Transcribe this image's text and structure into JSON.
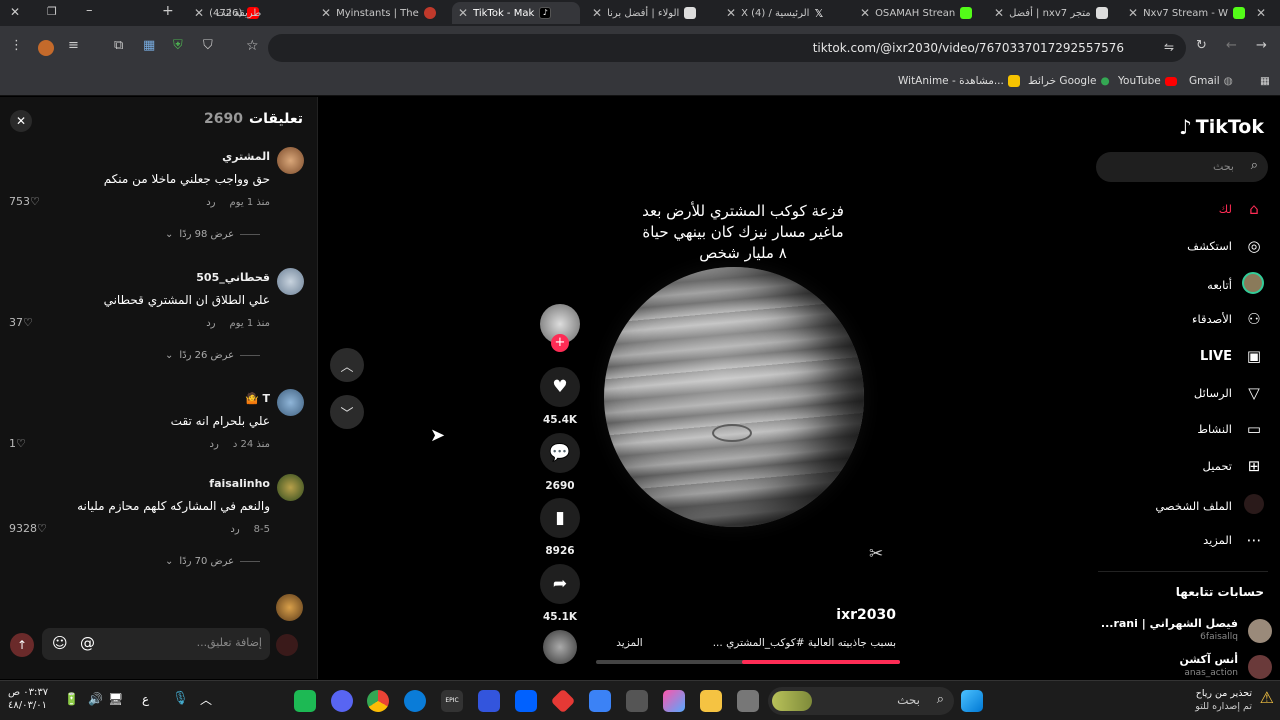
{
  "browser": {
    "tabs": [
      {
        "label": "طريقة انت",
        "active": false
      },
      {
        "label": "(4726)",
        "active": false
      },
      {
        "label": "Myinstants | The",
        "active": false
      },
      {
        "label": "TikTok - Mak",
        "active": true
      },
      {
        "label": "الولاء | أفضل برنا",
        "active": false
      },
      {
        "label": "الرئيسية / X (4)",
        "active": false
      },
      {
        "label": "OSAMAH Strean",
        "active": false
      },
      {
        "label": "متجر nxv7 | أفضل",
        "active": false
      },
      {
        "label": "Nxv7 Stream - W",
        "active": false
      }
    ],
    "url": "tiktok.com/@ixr2030/video/7670337017292557576",
    "bookmarks": [
      "Gmail",
      "YouTube",
      "خرائط Google",
      "WitAnime - مشاهدة..."
    ]
  },
  "comments": {
    "title": "تعليقات",
    "count": "2690",
    "close_icon": "close-icon",
    "items": [
      {
        "user": "المشتري",
        "text": "حق وواجب جعلني ماخلا من منكم",
        "time": "منذ 1 يوم",
        "reply": "رد",
        "likes": "753",
        "view_replies": "عرض 98 ردًا",
        "avatar_color": "#b07a4a"
      },
      {
        "user": "قحطاني_505",
        "text": "علي الطلاق ان المشتري قحطاني",
        "time": "منذ 1 يوم",
        "reply": "رد",
        "likes": "37",
        "view_replies": "عرض 26 ردًا",
        "avatar_color": "#8aa0b8"
      },
      {
        "user": "T 🤷",
        "text": "علي بلحرام انه تقت",
        "time": "منذ 24 د",
        "reply": "رد",
        "likes": "1",
        "view_replies": "",
        "avatar_color": "#6b8fb0"
      },
      {
        "user": "faisalinho",
        "text": "والنعم في المشاركه كلهم محازم مليانه",
        "time": "8-5",
        "reply": "رد",
        "likes": "9328",
        "view_replies": "عرض 70 ردًا",
        "avatar_color": "#3a5a2a"
      }
    ],
    "input_placeholder": "إضافة تعليق..."
  },
  "video": {
    "caption_lines": [
      "فزعة كوكب المشتري للأرض بعد",
      "ماغير مسار نيزك كان بينهي حياة",
      "٨ مليار شخص"
    ],
    "username": "ixr2030",
    "description": "بسبب جاذبيته العالية #كوكب_المشتري ...",
    "more": "المزيد",
    "progress": 0.52,
    "likes": "45.4K",
    "comments": "2690",
    "saves": "8926",
    "shares": "45.1K"
  },
  "sidenav": {
    "logo": "TikTok",
    "search_placeholder": "بحث",
    "items": [
      {
        "label": "لك",
        "icon": "home-icon",
        "color": "#fe2c55"
      },
      {
        "label": "استكشف",
        "icon": "compass-icon",
        "color": "#fff"
      },
      {
        "label": "أتابعه",
        "icon": "avatar-icon",
        "color": "#fff"
      },
      {
        "label": "الأصدقاء",
        "icon": "friends-icon",
        "color": "#fff"
      },
      {
        "label": "LIVE",
        "icon": "live-icon",
        "color": "#fff"
      },
      {
        "label": "الرسائل",
        "icon": "messages-icon",
        "color": "#fff"
      },
      {
        "label": "النشاط",
        "icon": "activity-icon",
        "color": "#fff"
      },
      {
        "label": "تحميل",
        "icon": "upload-icon",
        "color": "#fff"
      },
      {
        "label": "الملف الشخصي",
        "icon": "profile-icon",
        "color": "#fff"
      },
      {
        "label": "المزيد",
        "icon": "more-icon",
        "color": "#fff"
      }
    ],
    "following_title": "حسابات تتابعها",
    "following": [
      {
        "name": "فيصل الشهراني | rani...",
        "handle": "6faisallq"
      },
      {
        "name": "أنس آكشن",
        "handle": "anas_action"
      }
    ]
  },
  "taskbar": {
    "search": "بحث",
    "time": "٠٣:٣٧ ص",
    "date": "٤٨/٠٣/٠١",
    "lang": "ع",
    "notification_title": "تحذير من رياح",
    "notification_sub": "تم إصداره للتو"
  }
}
